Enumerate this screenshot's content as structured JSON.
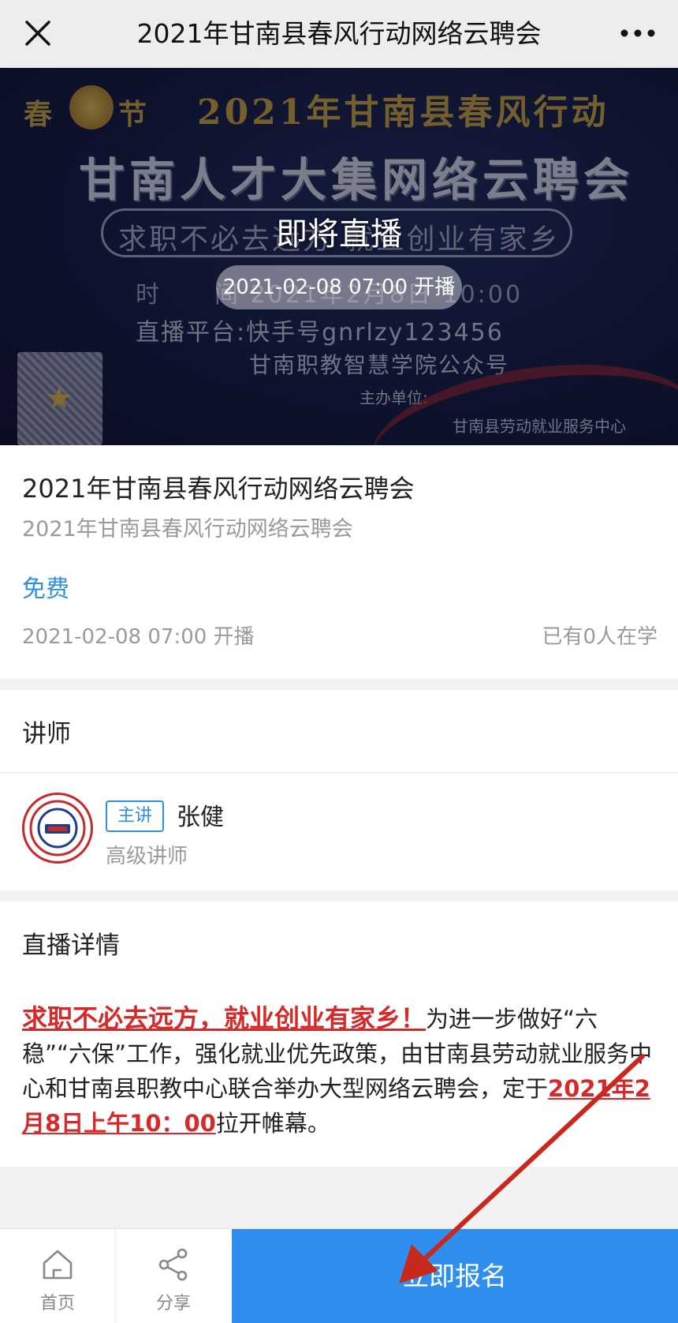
{
  "topbar": {
    "title": "2021年甘南县春风行动网络云聘会",
    "close_icon": "close-icon",
    "more_icon": "more-icon"
  },
  "banner": {
    "chun": "春",
    "jie": "节",
    "line1": "2021年甘南县春风行动",
    "line2": "甘南人才大集网络云聘会",
    "slogan": "求职不必去远方  就业创业有家乡",
    "time_label": "时",
    "time_value": "间 2021年2月8日 10:00",
    "platform": "直播平台:快手号gnrlzy123456",
    "platform2": "甘南职教智慧学院公众号",
    "organizer_label": "主办单位:",
    "organizer": "甘南县劳动就业服务中心",
    "live_status": "即将直播",
    "live_time": "2021-02-08 07:00 开播"
  },
  "course": {
    "title": "2021年甘南县春风行动网络云聘会",
    "subtitle": "2021年甘南县春风行动网络云聘会",
    "price": "免费",
    "start_time": "2021-02-08 07:00 开播",
    "learners": "已有0人在学"
  },
  "lecturer_section": {
    "heading": "讲师",
    "tag": "主讲",
    "name": "张健",
    "role": "高级讲师"
  },
  "detail_section": {
    "heading": "直播详情",
    "highlight": "求职不必去远方，就业创业有家乡！",
    "text1": "为进一步做好“六稳”“六保”工作，强化就业优先政策，由甘南县劳动就业服务中心和甘南县职教中心联合举办大型网络云聘会，定于",
    "date_highlight": "2021年2月8日上午10：00",
    "text2": "拉开帷幕。"
  },
  "bottombar": {
    "home_label": "首页",
    "share_label": "分享",
    "signup_label": "立即报名"
  },
  "colors": {
    "accent_blue": "#2f8fee",
    "price_blue": "#2f8fd8",
    "highlight_red": "#d42a2a",
    "arrow_red": "#c8281e"
  }
}
